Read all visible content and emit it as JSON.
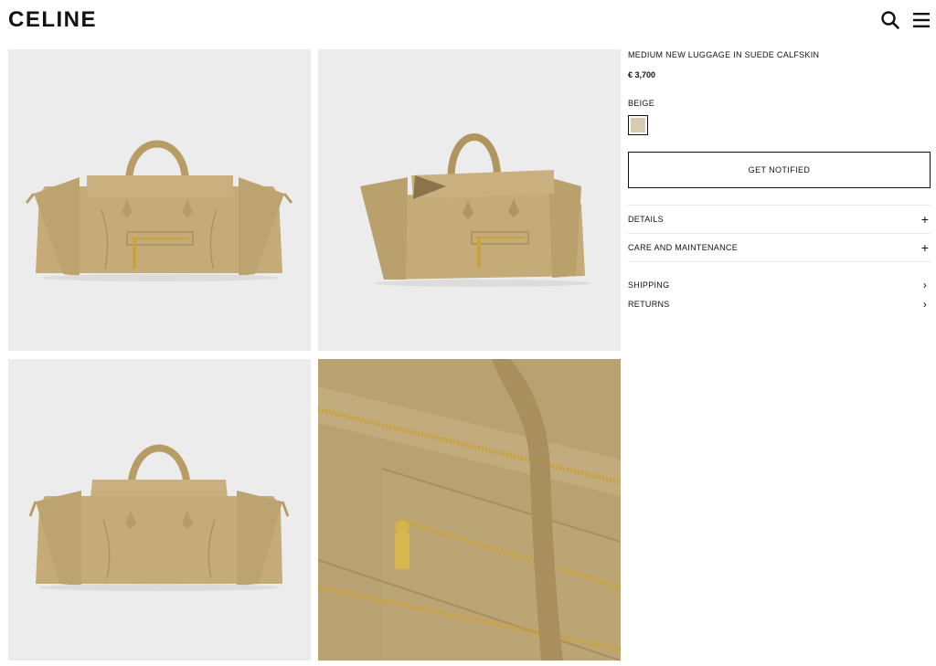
{
  "header": {
    "logo": "CELINE",
    "icons": {
      "search": "search-icon",
      "menu": "hamburger-menu-icon"
    }
  },
  "gallery": {
    "images": [
      {
        "view": "front"
      },
      {
        "view": "three-quarter"
      },
      {
        "view": "back"
      },
      {
        "view": "detail-zipper"
      }
    ]
  },
  "product": {
    "name": "MEDIUM NEW LUGGAGE IN SUEDE CALFSKIN",
    "price": "€ 3,700",
    "color_label": "BEIGE",
    "swatch_color": "#d9cbb0",
    "notify_label": "GET NOTIFIED"
  },
  "accordion": [
    {
      "label": "DETAILS",
      "icon": "+"
    },
    {
      "label": "CARE AND MAINTENANCE",
      "icon": "+"
    }
  ],
  "links": [
    {
      "label": "SHIPPING",
      "icon": "›"
    },
    {
      "label": "RETURNS",
      "icon": "›"
    }
  ],
  "colors": {
    "suede": "#c4ab78",
    "suede_dark": "#a98f5d",
    "gold": "#c9a23a",
    "tile_bg": "#ececec"
  }
}
